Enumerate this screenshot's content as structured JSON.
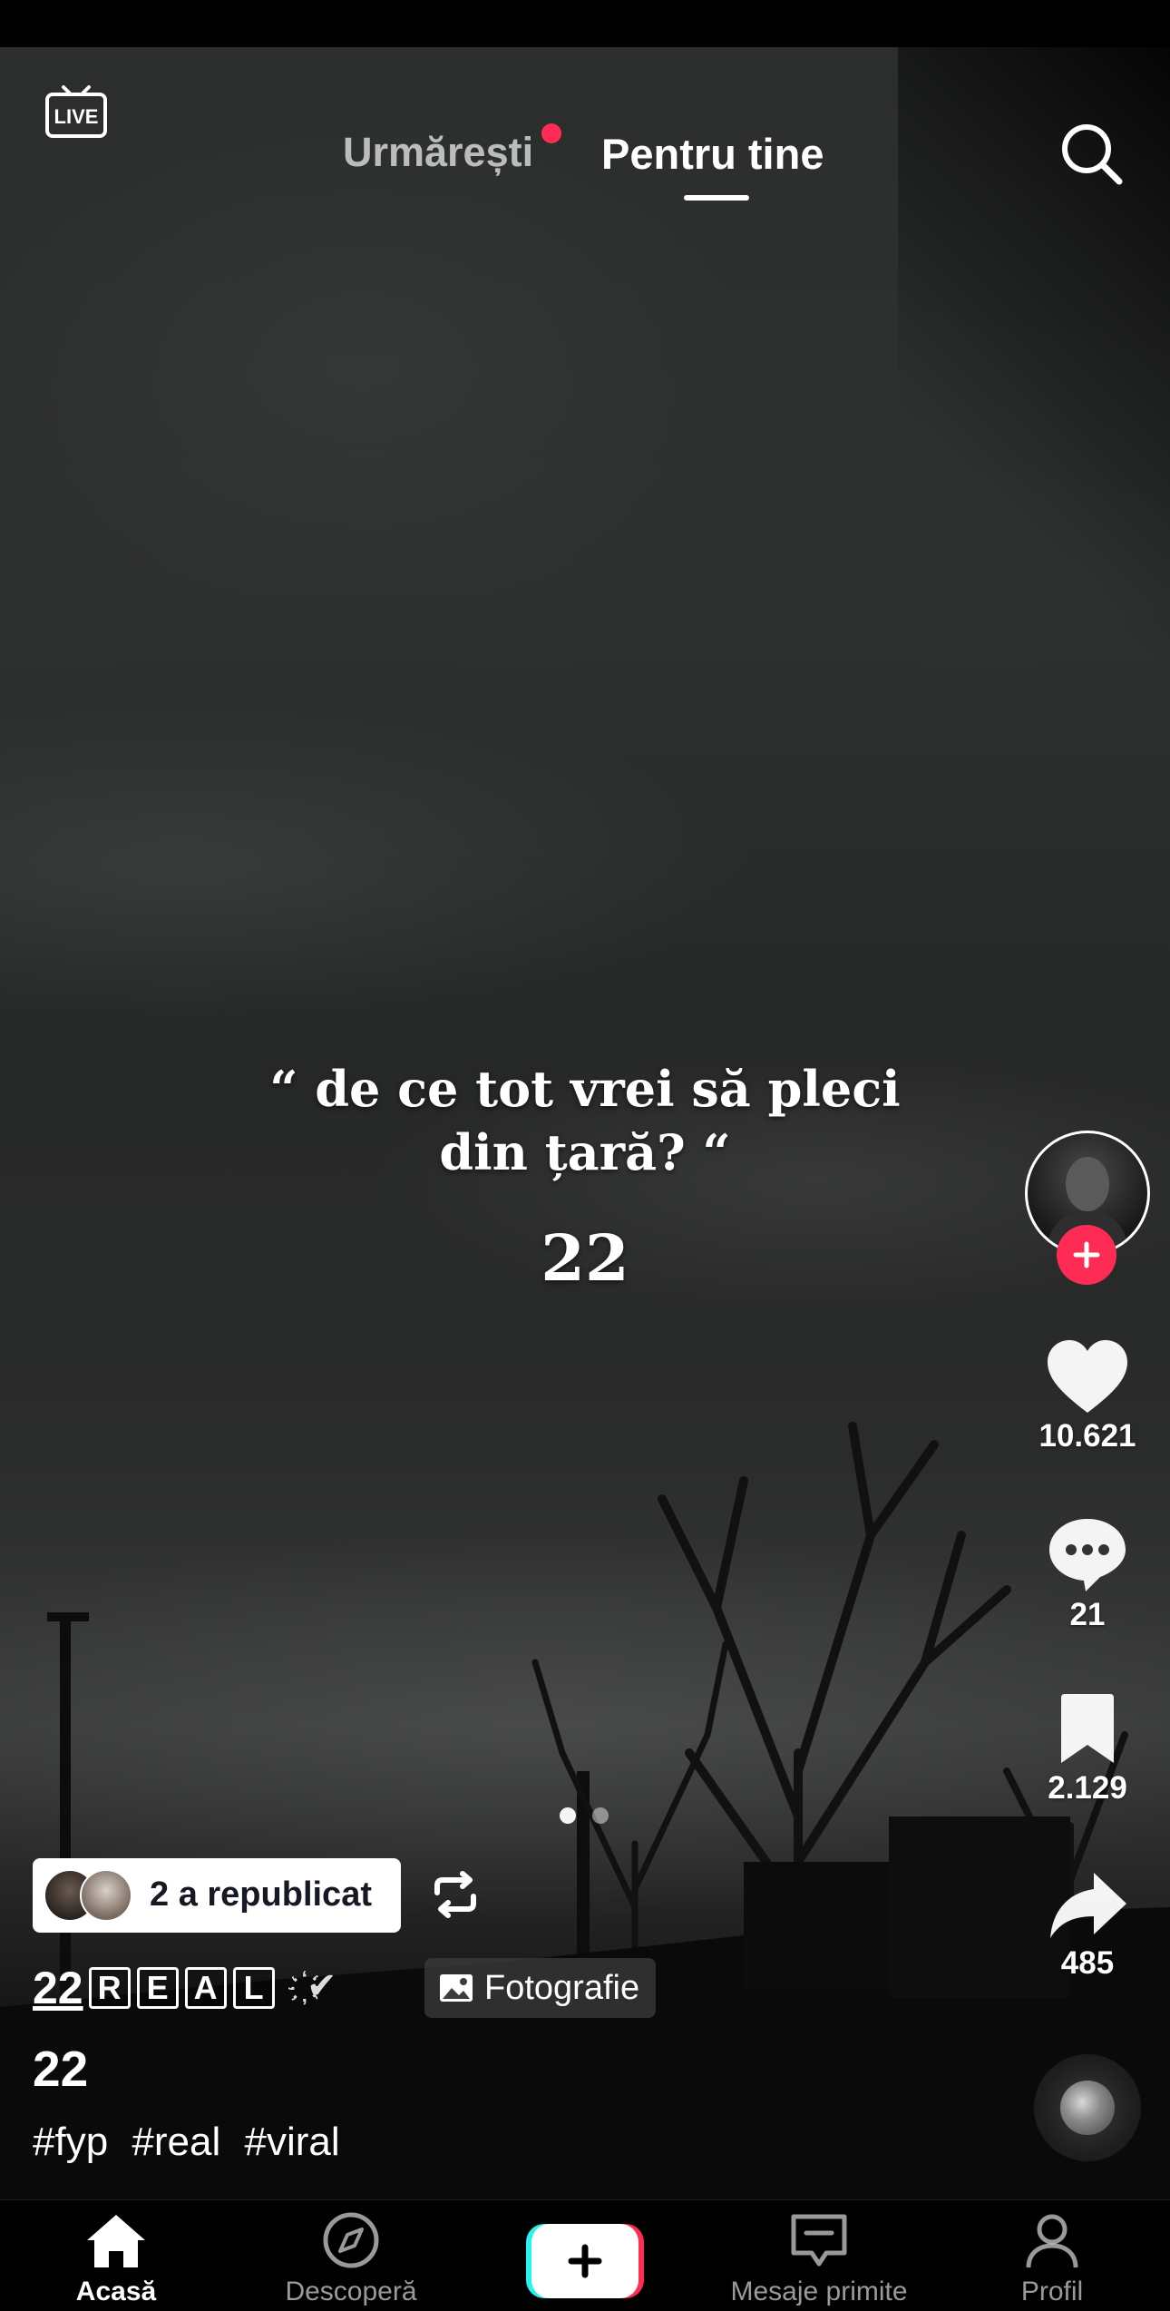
{
  "top_nav": {
    "live_label": "LIVE",
    "tab_following": "Urmărești",
    "tab_for_you": "Pentru tine",
    "active_tab": "Pentru tine",
    "following_has_notification": true
  },
  "post": {
    "overlay_quote": "“ de ce tot vrei să pleci din țară? “",
    "overlay_number": "22",
    "carousel": {
      "total": 2,
      "current": 1
    },
    "repost": {
      "label": "2 a republicat"
    },
    "author": {
      "prefix": "22",
      "boxed_letters": [
        "R",
        "E",
        "A",
        "L"
      ],
      "decoration": "҉✔"
    },
    "type_badge": "Fotografie",
    "description": "22",
    "hashtags": [
      "#fyp",
      "#real",
      "#viral"
    ]
  },
  "actions": {
    "likes": "10.621",
    "comments": "21",
    "saves": "2.129",
    "shares": "485"
  },
  "bottom_nav": {
    "items": [
      {
        "label": "Acasă",
        "icon": "home-icon",
        "active": true
      },
      {
        "label": "Descoperă",
        "icon": "compass-icon",
        "active": false
      },
      {
        "label": "",
        "icon": "plus-icon",
        "active": false
      },
      {
        "label": "Mesaje primite",
        "icon": "inbox-icon",
        "active": false
      },
      {
        "label": "Profil",
        "icon": "profile-icon",
        "active": false
      }
    ]
  },
  "colors": {
    "accent": "#fe2c55",
    "create_cyan": "#25f4ee",
    "create_pink": "#fe2c55",
    "text_dark": "#161823"
  }
}
